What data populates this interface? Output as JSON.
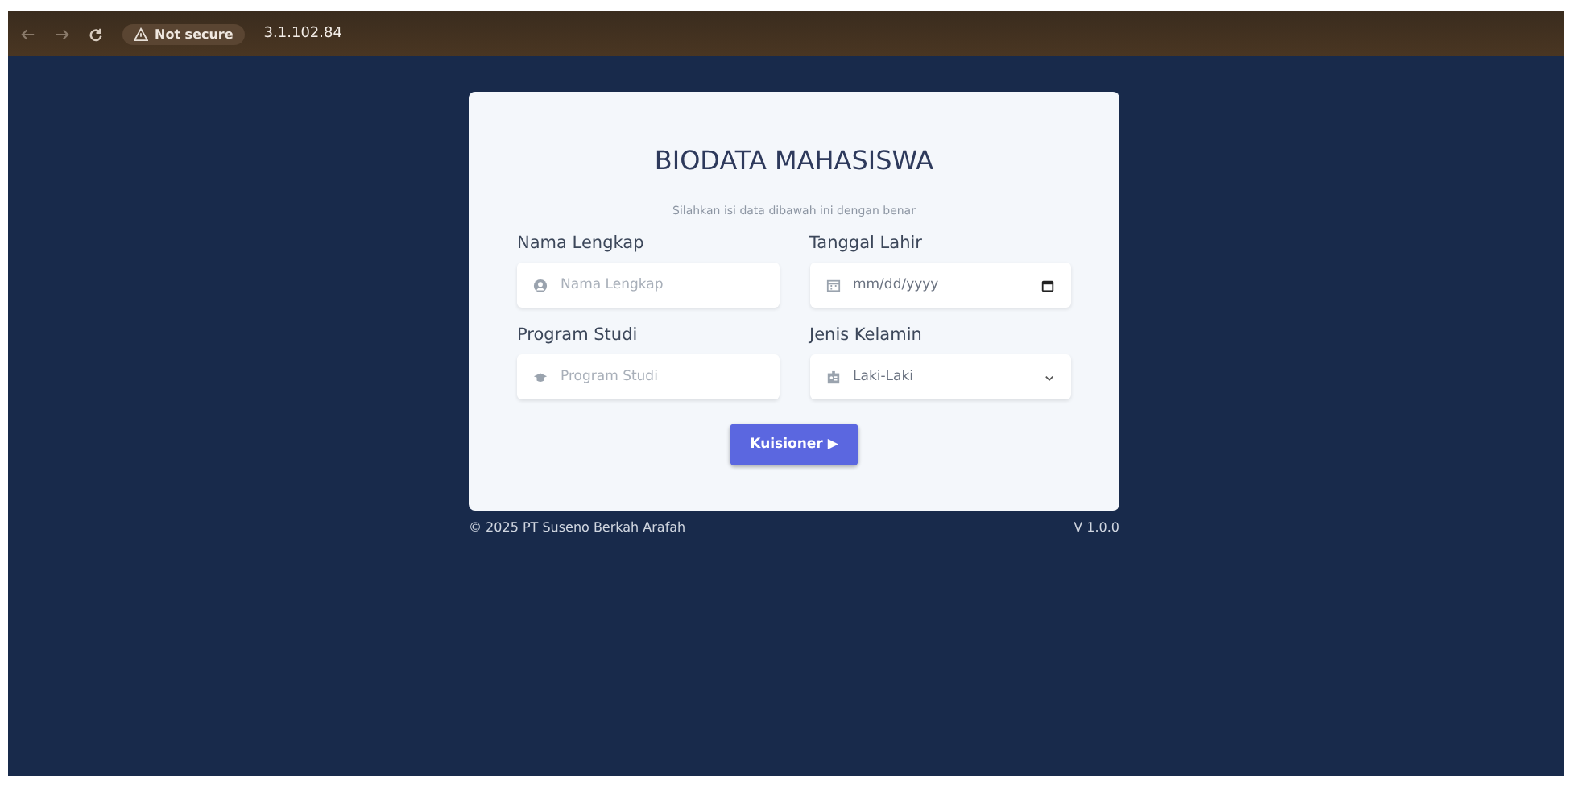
{
  "browser": {
    "security": "Not secure",
    "url": "3.1.102.84"
  },
  "form": {
    "title": "BIODATA MAHASISWA",
    "subtitle": "Silahkan isi data dibawah ini dengan benar",
    "fields": [
      {
        "kind": "text",
        "label": "Nama Lengkap",
        "placeholder": "Nama Lengkap"
      },
      {
        "kind": "date",
        "label": "Tanggal Lahir",
        "placeholder": "mm/dd/yyyy"
      },
      {
        "kind": "text",
        "label": "Program Studi",
        "placeholder": "Program Studi"
      },
      {
        "kind": "select",
        "label": "Jenis Kelamin",
        "value": "Laki-Laki"
      }
    ],
    "submit": {
      "label": "Kuisioner",
      "glyph": "▶"
    }
  },
  "footer": {
    "copyright": "© 2025 PT Suseno Berkah Arafah",
    "version": "V 1.0.0"
  }
}
